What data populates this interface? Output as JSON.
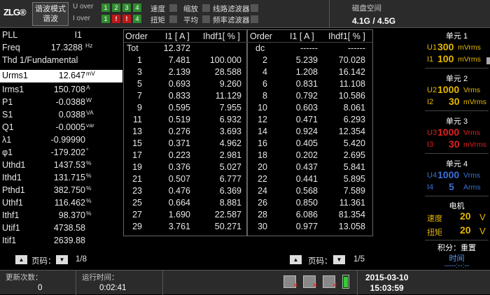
{
  "header": {
    "logo": "ZLG®",
    "mode_line1": "谐波模式",
    "mode_line2": "谐波",
    "u_over_label": "U over",
    "i_over_label": "I over",
    "u_over": [
      "1",
      "2",
      "3",
      "4"
    ],
    "i_over": [
      "1",
      "!",
      "!",
      "4"
    ],
    "flag_speed": "速度",
    "flag_torque": "扭矩",
    "flag_zoom": "缩放",
    "flag_avg": "平均",
    "flag_line_filter": "线路滤波器",
    "flag_freq_filter": "频率滤波器",
    "disk_label": "磁盘空间",
    "disk_value": "4.1G / 4.5G"
  },
  "params": [
    {
      "label": "PLL",
      "value": "I1",
      "unit": ""
    },
    {
      "label": "Freq",
      "value": "17.3288",
      "unit": "Hz"
    },
    {
      "label": "Thd  1/Fundamental",
      "value": "",
      "unit": ""
    },
    {
      "label": "Urms1",
      "value": "12.647",
      "unit": "mV"
    },
    {
      "label": "Irms1",
      "value": "150.708",
      "unit": "A"
    },
    {
      "label": "P1",
      "value": "-0.0388",
      "unit": "W"
    },
    {
      "label": "S1",
      "value": "0.0388",
      "unit": "VA"
    },
    {
      "label": "Q1",
      "value": "-0.0005",
      "unit": "var"
    },
    {
      "label": "λ1",
      "value": "-0.99990",
      "unit": ""
    },
    {
      "label": "φ1",
      "value": "-179.202",
      "unit": "°"
    },
    {
      "label": "Uthd1",
      "value": "1437.53",
      "unit": "%"
    },
    {
      "label": "Ithd1",
      "value": "131.715",
      "unit": "%"
    },
    {
      "label": "Pthd1",
      "value": "382.750",
      "unit": "%"
    },
    {
      "label": "Uthf1",
      "value": "116.462",
      "unit": "%"
    },
    {
      "label": "Ithf1",
      "value": "98.370",
      "unit": "%"
    },
    {
      "label": "Utif1",
      "value": "4738.58",
      "unit": ""
    },
    {
      "label": "Itif1",
      "value": "2639.88",
      "unit": ""
    }
  ],
  "table_left": {
    "headers": [
      "Order",
      "I1 [ A ]",
      "Ihdf1[ % ]"
    ],
    "rows": [
      [
        "Tot",
        "12.372",
        ""
      ],
      [
        "1",
        "7.481",
        "100.000"
      ],
      [
        "3",
        "2.139",
        "28.588"
      ],
      [
        "5",
        "0.693",
        "9.260"
      ],
      [
        "7",
        "0.833",
        "11.129"
      ],
      [
        "9",
        "0.595",
        "7.955"
      ],
      [
        "11",
        "0.519",
        "6.932"
      ],
      [
        "13",
        "0.276",
        "3.693"
      ],
      [
        "15",
        "0.371",
        "4.962"
      ],
      [
        "17",
        "0.223",
        "2.981"
      ],
      [
        "19",
        "0.376",
        "5.027"
      ],
      [
        "21",
        "0.507",
        "6.777"
      ],
      [
        "23",
        "0.476",
        "6.369"
      ],
      [
        "25",
        "0.664",
        "8.881"
      ],
      [
        "27",
        "1.690",
        "22.587"
      ],
      [
        "29",
        "3.761",
        "50.271"
      ]
    ]
  },
  "table_right": {
    "headers": [
      "Order",
      "I1 [ A ]",
      "Ihdf1[ % ]"
    ],
    "rows": [
      [
        "dc",
        "------",
        "------"
      ],
      [
        "2",
        "5.239",
        "70.028"
      ],
      [
        "4",
        "1.208",
        "16.142"
      ],
      [
        "6",
        "0.831",
        "11.108"
      ],
      [
        "8",
        "0.792",
        "10.586"
      ],
      [
        "10",
        "0.603",
        "8.061"
      ],
      [
        "12",
        "0.471",
        "6.293"
      ],
      [
        "14",
        "0.924",
        "12.354"
      ],
      [
        "16",
        "0.405",
        "5.420"
      ],
      [
        "18",
        "0.202",
        "2.695"
      ],
      [
        "20",
        "0.437",
        "5.841"
      ],
      [
        "22",
        "0.441",
        "5.895"
      ],
      [
        "24",
        "0.568",
        "7.589"
      ],
      [
        "26",
        "0.850",
        "11.361"
      ],
      [
        "28",
        "6.086",
        "81.354"
      ],
      [
        "30",
        "0.977",
        "13.058"
      ]
    ]
  },
  "pager_left": {
    "label": "页码：",
    "value": "1/8"
  },
  "pager_right": {
    "label": "页码：",
    "value": "1/5"
  },
  "footer": {
    "update_label": "更新次数：",
    "update_value": "0",
    "runtime_label": "运行时间：",
    "runtime_value": "0:02:41",
    "date": "2015-03-10",
    "time": "15:03:59"
  },
  "units": [
    {
      "title": "单元 1",
      "l1": "U1",
      "v1": "300",
      "u1": "mVrms",
      "l2": "I1",
      "v2": "100",
      "u2": "mVrms",
      "color": "#e6b800"
    },
    {
      "title": "单元 2",
      "l1": "U2",
      "v1": "1000",
      "u1": "Vrms",
      "l2": "I2",
      "v2": "30",
      "u2": "mVrms",
      "color": "#e6b800"
    },
    {
      "title": "单元 3",
      "l1": "U3",
      "v1": "1000",
      "u1": "Vrms",
      "l2": "I3",
      "v2": "30",
      "u2": "mVrms",
      "color": "#e02020"
    },
    {
      "title": "单元 4",
      "l1": "U4",
      "v1": "1000",
      "u1": "Vrms",
      "l2": "I4",
      "v2": "5",
      "u2": "Arms",
      "color": "#3a6fd8"
    }
  ],
  "motor": {
    "title": "电机",
    "speed_label": "速度",
    "speed_value": "20",
    "speed_unit": "V",
    "torque_label": "扭矩",
    "torque_value": "20",
    "torque_unit": "V"
  },
  "integ": {
    "title": "积分：重置",
    "label": "时间",
    "value": "-----:--:--"
  }
}
